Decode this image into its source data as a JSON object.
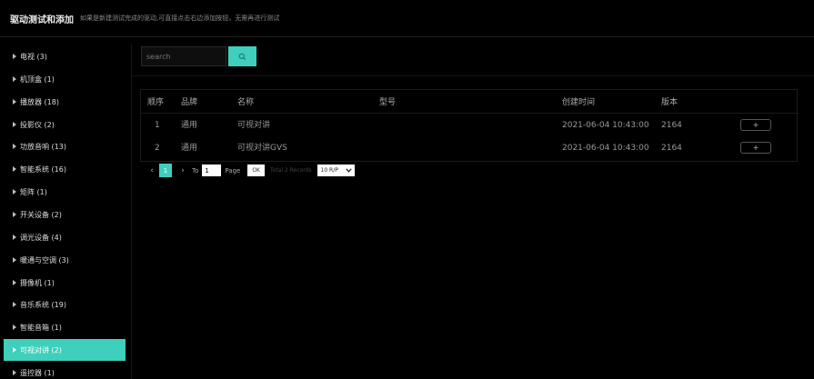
{
  "header": {
    "title": "驱动测试和添加",
    "hint": "如果是新建测试完成的驱动,可直接点击右边添加按钮，无需再进行测试"
  },
  "sidebar": {
    "items": [
      {
        "label": "电视 (3)"
      },
      {
        "label": "机顶盒 (1)"
      },
      {
        "label": "播放器 (18)"
      },
      {
        "label": "投影仪 (2)"
      },
      {
        "label": "功放音响 (13)"
      },
      {
        "label": "智能系统 (16)"
      },
      {
        "label": "矩阵 (1)"
      },
      {
        "label": "开关设备 (2)"
      },
      {
        "label": "调光设备 (4)"
      },
      {
        "label": "暖通与空调 (3)"
      },
      {
        "label": "摄像机 (1)"
      },
      {
        "label": "音乐系统 (19)"
      },
      {
        "label": "智能音箱 (1)"
      },
      {
        "label": "可视对讲 (2)",
        "active": true
      },
      {
        "label": "遥控器 (1)"
      }
    ]
  },
  "search": {
    "placeholder": "search"
  },
  "table": {
    "headers": {
      "seq": "顺序",
      "brand": "品牌",
      "name": "名称",
      "model": "型号",
      "created": "创建时间",
      "version": "版本"
    },
    "rows": [
      {
        "seq": "1",
        "brand": "通用",
        "name": "可视对讲",
        "model": "",
        "created": "2021-06-04 10:43:00",
        "version": "2164",
        "action": "+"
      },
      {
        "seq": "2",
        "brand": "通用",
        "name": "可视对讲GVS",
        "model": "",
        "created": "2021-06-04 10:43:00",
        "version": "2164",
        "action": "+"
      }
    ]
  },
  "pagination": {
    "current_page": "1",
    "to_label": "To",
    "page_input": "1",
    "page_label": "Page",
    "ok_label": "OK",
    "total_label": "Total 2 Records",
    "page_size": "10 R/P"
  },
  "colors": {
    "accent": "#3ecfbd",
    "background": "#000000"
  }
}
